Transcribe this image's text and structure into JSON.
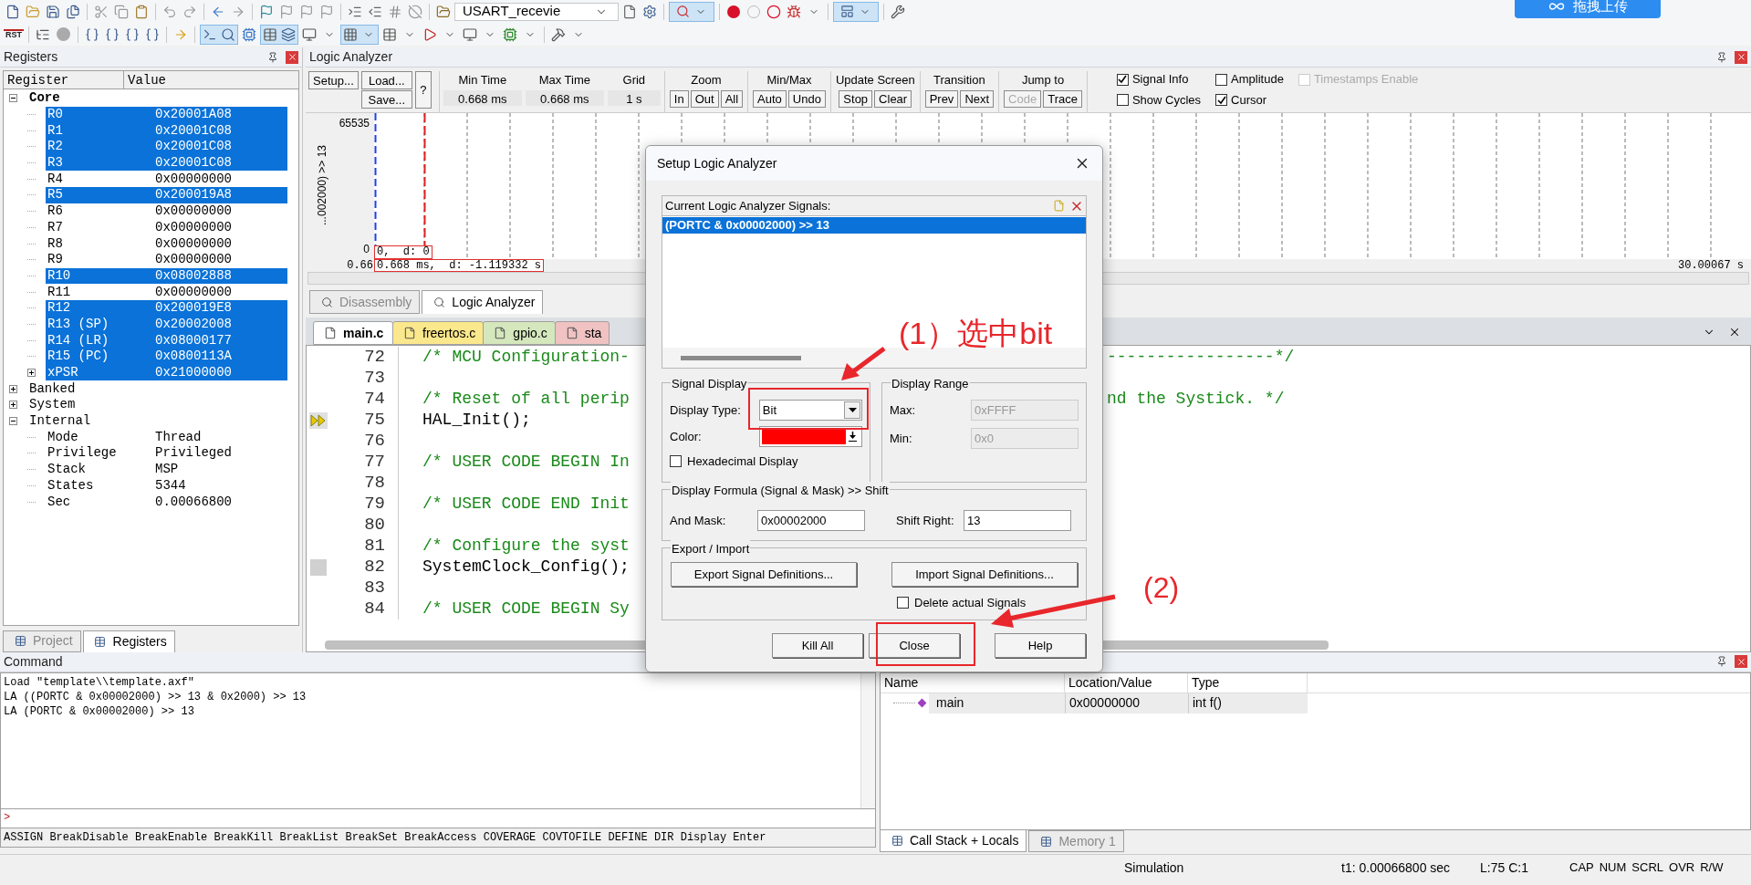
{
  "toolbar": {
    "project_target": "USART_recevie",
    "reset_label": "RST"
  },
  "upload_button": {
    "label": "拖拽上传"
  },
  "registers": {
    "title": "Registers",
    "columns": [
      "Register",
      "Value"
    ],
    "tree": [
      {
        "name": "Core",
        "bold": true,
        "expanded": true,
        "children": [
          {
            "name": "R0",
            "value": "0x20001A08",
            "selected": true
          },
          {
            "name": "R1",
            "value": "0x20001C08",
            "selected": true
          },
          {
            "name": "R2",
            "value": "0x20001C08",
            "selected": true
          },
          {
            "name": "R3",
            "value": "0x20001C08",
            "selected": true
          },
          {
            "name": "R4",
            "value": "0x00000000",
            "selected": false
          },
          {
            "name": "R5",
            "value": "0x200019A8",
            "selected": true
          },
          {
            "name": "R6",
            "value": "0x00000000",
            "selected": false
          },
          {
            "name": "R7",
            "value": "0x00000000",
            "selected": false
          },
          {
            "name": "R8",
            "value": "0x00000000",
            "selected": false
          },
          {
            "name": "R9",
            "value": "0x00000000",
            "selected": false
          },
          {
            "name": "R10",
            "value": "0x08002888",
            "selected": true
          },
          {
            "name": "R11",
            "value": "0x00000000",
            "selected": false
          },
          {
            "name": "R12",
            "value": "0x200019E8",
            "selected": true
          },
          {
            "name": "R13 (SP)",
            "value": "0x20002008",
            "selected": true
          },
          {
            "name": "R14 (LR)",
            "value": "0x08000177",
            "selected": true
          },
          {
            "name": "R15 (PC)",
            "value": "0x0800113A",
            "selected": true
          },
          {
            "name": "xPSR",
            "value": "0x21000000",
            "selected": true,
            "expanded": false
          }
        ]
      },
      {
        "name": "Banked",
        "expanded": false
      },
      {
        "name": "System",
        "expanded": false
      },
      {
        "name": "Internal",
        "expanded": true,
        "children": [
          {
            "name": "Mode",
            "value": "Thread",
            "selected": false
          },
          {
            "name": "Privilege",
            "value": "Privileged",
            "selected": false
          },
          {
            "name": "Stack",
            "value": "MSP",
            "selected": false
          },
          {
            "name": "States",
            "value": "5344",
            "selected": false
          },
          {
            "name": "Sec",
            "value": "0.00066800",
            "selected": false
          }
        ]
      }
    ],
    "tabs": [
      {
        "label": "Project",
        "selected": false
      },
      {
        "label": "Registers",
        "selected": true
      }
    ]
  },
  "logic_analyzer": {
    "title": "Logic Analyzer",
    "setup": "Setup...",
    "load": "Load...",
    "save": "Save...",
    "help": "?",
    "fields": [
      {
        "label": "Min Time",
        "value": "0.668 ms"
      },
      {
        "label": "Max Time",
        "value": "0.668 ms"
      },
      {
        "label": "Grid",
        "value": "1 s"
      }
    ],
    "groups": [
      {
        "title": "Zoom",
        "buttons": [
          {
            "label": "In",
            "disabled": false
          },
          {
            "label": "Out",
            "disabled": false
          },
          {
            "label": "All",
            "disabled": false
          }
        ]
      },
      {
        "title": "Min/Max",
        "buttons": [
          {
            "label": "Auto",
            "disabled": false
          },
          {
            "label": "Undo",
            "disabled": false
          }
        ]
      },
      {
        "title": "Update Screen",
        "buttons": [
          {
            "label": "Stop",
            "disabled": false
          },
          {
            "label": "Clear",
            "disabled": false
          }
        ]
      },
      {
        "title": "Transition",
        "buttons": [
          {
            "label": "Prev",
            "disabled": false
          },
          {
            "label": "Next",
            "disabled": false
          }
        ]
      },
      {
        "title": "Jump to",
        "buttons": [
          {
            "label": "Code",
            "disabled": true
          },
          {
            "label": "Trace",
            "disabled": false
          }
        ]
      }
    ],
    "checkboxes": [
      {
        "label": "Signal Info",
        "checked": true,
        "disabled": false
      },
      {
        "label": "Show Cycles",
        "checked": false,
        "disabled": false
      },
      {
        "label": "Amplitude",
        "checked": false,
        "disabled": false
      },
      {
        "label": "Cursor",
        "checked": true,
        "disabled": false
      },
      {
        "label": "Timestamps Enable",
        "checked": false,
        "disabled": true
      }
    ],
    "plot": {
      "y_max": "65535",
      "y_min": "0",
      "signal_label": "...002000) >> 13",
      "cursor_info": "0,  d: 0",
      "start_time": "0.66",
      "time_info": "0.668 ms,  d: -1.119332 s",
      "end_time": "30.00067 s"
    }
  },
  "view_tabs": [
    {
      "label": "Disassembly",
      "selected": false
    },
    {
      "label": "Logic Analyzer",
      "selected": true
    }
  ],
  "editor": {
    "tabs": [
      {
        "label": "main.c",
        "selected": true,
        "color": "#ffffff"
      },
      {
        "label": "freertos.c",
        "selected": false,
        "color": "#fbe88c"
      },
      {
        "label": "gpio.c",
        "selected": false,
        "color": "#d4e7bd"
      },
      {
        "label": "sta",
        "selected": false,
        "color": "#f0c2c2"
      }
    ],
    "lines": [
      {
        "number": "72",
        "kind": "comment",
        "text": "/* MCU Configuration-",
        "text_right": "-----------------*/"
      },
      {
        "number": "73",
        "kind": "blank"
      },
      {
        "number": "74",
        "kind": "comment",
        "text": "/* Reset of all perip",
        "text_right": "nd the Systick. */"
      },
      {
        "number": "75",
        "kind": "code",
        "text": "HAL_Init();",
        "current": true
      },
      {
        "number": "76",
        "kind": "blank"
      },
      {
        "number": "77",
        "kind": "comment",
        "text": "/* USER CODE BEGIN In"
      },
      {
        "number": "78",
        "kind": "blank"
      },
      {
        "number": "79",
        "kind": "comment",
        "text": "/* USER CODE END Init"
      },
      {
        "number": "80",
        "kind": "blank"
      },
      {
        "number": "81",
        "kind": "comment",
        "text": "/* Configure the syst"
      },
      {
        "number": "82",
        "kind": "code",
        "text": "SystemClock_Config();",
        "executed": true
      },
      {
        "number": "83",
        "kind": "blank"
      },
      {
        "number": "84",
        "kind": "comment",
        "text": "/* USER CODE BEGIN Sy"
      }
    ]
  },
  "command": {
    "title": "Command",
    "output": [
      "Load \"template\\\\template.axf\"",
      "LA ((PORTC & 0x00002000) >> 13 & 0x2000) >> 13",
      "LA (PORTC & 0x00002000) >> 13"
    ],
    "prompt": ">",
    "help": "ASSIGN BreakDisable BreakEnable BreakKill BreakList BreakSet BreakAccess COVERAGE COVTOFILE DEFINE DIR Display Enter"
  },
  "call_stack": {
    "columns": [
      "Name",
      "Location/Value",
      "Type"
    ],
    "rows": [
      {
        "name": "main",
        "location": "0x00000000",
        "type": "int f()"
      }
    ],
    "tabs": [
      {
        "label": "Call Stack + Locals",
        "selected": true
      },
      {
        "label": "Memory 1",
        "selected": false
      }
    ]
  },
  "status_bar": {
    "items": [
      "Simulation",
      "t1: 0.00066800 sec",
      "L:75 C:1"
    ],
    "indicators": [
      "CAP",
      "NUM",
      "SCRL",
      "OVR",
      "R/W"
    ]
  },
  "dialog": {
    "title": "Setup Logic Analyzer",
    "signals_label": "Current Logic Analyzer Signals:",
    "signals": [
      {
        "label": "(PORTC & 0x00002000) >> 13",
        "selected": true
      }
    ],
    "signal_display": {
      "title": "Signal Display",
      "type_label": "Display Type:",
      "type_value": "Bit",
      "color_label": "Color:",
      "color": "#ff0000",
      "hex_label": "Hexadecimal Display",
      "hex_checked": false
    },
    "display_range": {
      "title": "Display Range",
      "max_label": "Max:",
      "max_value": "0xFFFF",
      "min_label": "Min:",
      "min_value": "0x0",
      "disabled": true
    },
    "formula": {
      "title": "Display Formula (Signal & Mask) >> Shift",
      "mask_label": "And Mask:",
      "mask_value": "0x00002000",
      "shift_label": "Shift Right:",
      "shift_value": "13"
    },
    "export_import": {
      "title": "Export / Import",
      "export": "Export Signal Definitions...",
      "import": "Import Signal Definitions...",
      "delete_label": "Delete actual Signals",
      "delete_checked": false
    },
    "buttons": [
      "Kill All",
      "Close",
      "Help"
    ]
  },
  "annotations": [
    {
      "text": "(1）选中bit"
    },
    {
      "text": "(2)"
    }
  ]
}
